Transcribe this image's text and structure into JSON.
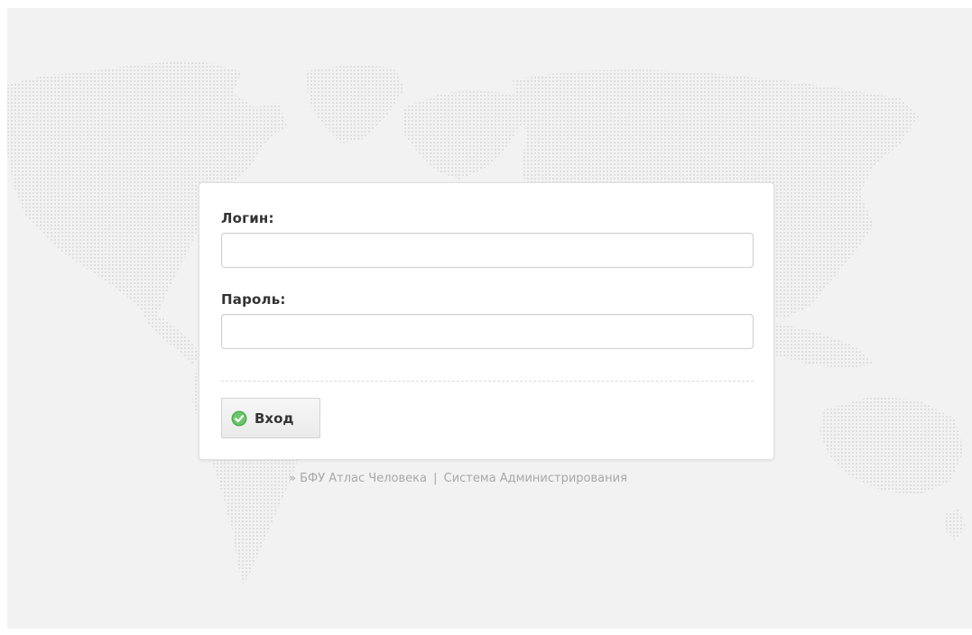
{
  "login_form": {
    "login_label": "Логин:",
    "login_value": "",
    "password_label": "Пароль:",
    "password_value": "",
    "submit_label": "Вход",
    "submit_icon": "check-circle-icon"
  },
  "footer": {
    "prefix": "»",
    "app_name": "БФУ Атлас Человека",
    "separator": "|",
    "system_name": "Система Администрирования"
  },
  "colors": {
    "background": "#f2f2f2",
    "map_dots": "#e2e2e2",
    "card": "#ffffff",
    "accent_green": "#5cb85c"
  },
  "background_image": "world-map-dots"
}
